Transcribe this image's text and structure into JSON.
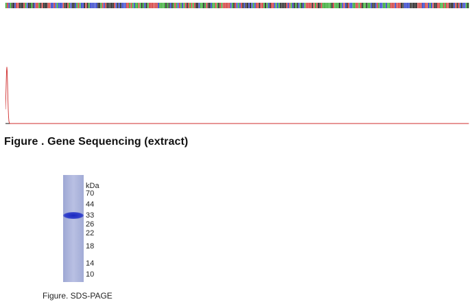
{
  "sequencing": {
    "caption": "Figure . Gene Sequencing (extract)",
    "base_colors": {
      "A": "#21a21f",
      "C": "#1e2fc4",
      "G": "#111111",
      "T": "#cf2b2b"
    }
  },
  "gel": {
    "caption": "Figure. SDS-PAGE",
    "unit": "kDa",
    "markers": [
      "70",
      "44",
      "33",
      "26",
      "22",
      "18",
      "14",
      "10"
    ],
    "lane_color": "#aab2da",
    "band_color": "#2b39c8"
  }
}
